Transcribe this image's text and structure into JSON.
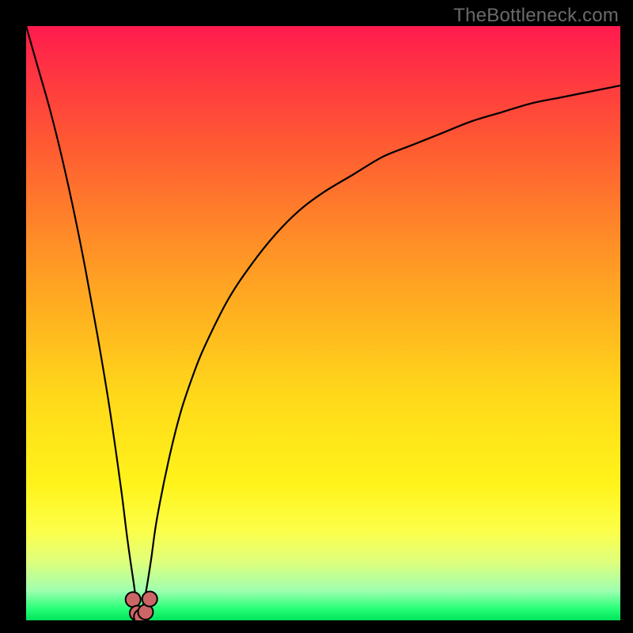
{
  "watermark": {
    "text": "TheBottleneck.com"
  },
  "colors": {
    "background": "#000000",
    "curve_stroke": "#000000",
    "marker_stroke": "#000000",
    "marker_fill": "#cc6666",
    "watermark_text": "#6a6a6a"
  },
  "chart_data": {
    "type": "line",
    "title": "",
    "xlabel": "",
    "ylabel": "",
    "xlim": [
      0,
      100
    ],
    "ylim": [
      0,
      100
    ],
    "grid": false,
    "legend": false,
    "notes": "Bottleneck-style V curve: y approaches 100 at the left edge, dips to ~0 near x≈19, and rises asymptotically toward ~90 on the right. Axes have no tick labels; background is a vertical red→orange→yellow→green gradient.",
    "series": [
      {
        "name": "curve",
        "x": [
          0,
          2,
          4,
          6,
          8,
          10,
          12,
          14,
          16,
          17,
          18,
          19,
          20,
          21,
          22,
          24,
          26,
          28,
          30,
          34,
          38,
          42,
          46,
          50,
          55,
          60,
          65,
          70,
          75,
          80,
          85,
          90,
          95,
          100
        ],
        "values": [
          100,
          93,
          86,
          78,
          69,
          59,
          48,
          36,
          22,
          14,
          7,
          1,
          4,
          10,
          17,
          27,
          35,
          41,
          46,
          54,
          60,
          65,
          69,
          72,
          75,
          78,
          80,
          82,
          84,
          85.5,
          87,
          88,
          89,
          90
        ]
      }
    ],
    "markers": [
      {
        "x": 18.0,
        "y": 3.5
      },
      {
        "x": 18.7,
        "y": 1.2
      },
      {
        "x": 19.4,
        "y": 0.6
      },
      {
        "x": 20.1,
        "y": 1.4
      },
      {
        "x": 20.8,
        "y": 3.6
      }
    ]
  }
}
